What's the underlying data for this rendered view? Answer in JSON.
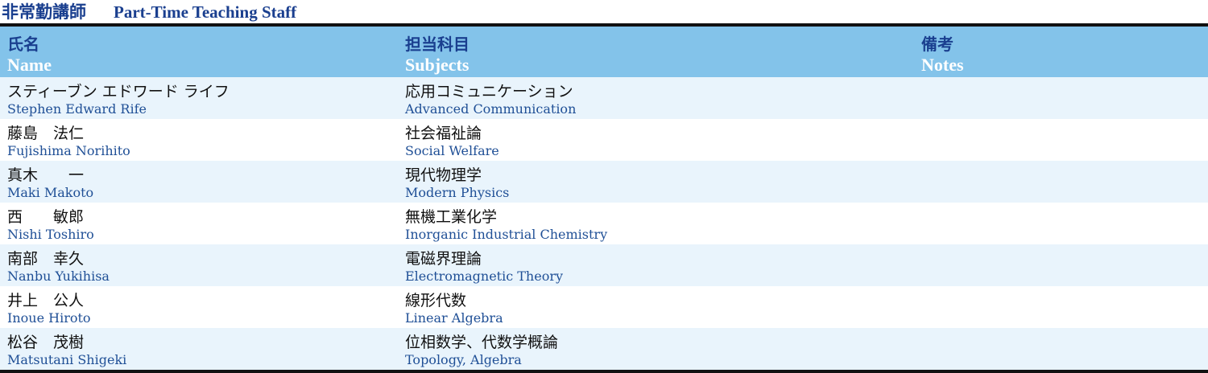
{
  "title": {
    "ja": "非常勤講師",
    "en": "Part-Time Teaching Staff"
  },
  "headers": {
    "name": {
      "ja": "氏名",
      "en": "Name"
    },
    "subjects": {
      "ja": "担当科目",
      "en": "Subjects"
    },
    "notes": {
      "ja": "備考",
      "en": "Notes"
    }
  },
  "rows": [
    {
      "name_ja": "スティーブン エドワード ライフ",
      "name_en": "Stephen Edward Rife",
      "subject_ja": "応用コミュニケーション",
      "subject_en": "Advanced Communication"
    },
    {
      "name_ja": "藤島　法仁",
      "name_en": "Fujishima Norihito",
      "subject_ja": "社会福祉論",
      "subject_en": "Social Welfare"
    },
    {
      "name_ja": "真木　　一",
      "name_en": "Maki Makoto",
      "subject_ja": "現代物理学",
      "subject_en": "Modern Physics"
    },
    {
      "name_ja": "西　　敏郎",
      "name_en": "Nishi Toshiro",
      "subject_ja": "無機工業化学",
      "subject_en": "Inorganic Industrial Chemistry"
    },
    {
      "name_ja": "南部　幸久",
      "name_en": "Nanbu Yukihisa",
      "subject_ja": "電磁界理論",
      "subject_en": "Electromagnetic Theory"
    },
    {
      "name_ja": "井上　公人",
      "name_en": "Inoue Hiroto",
      "subject_ja": "線形代数",
      "subject_en": "Linear Algebra"
    },
    {
      "name_ja": "松谷　茂樹",
      "name_en": "Matsutani Shigeki",
      "subject_ja": "位相数学、代数学概論",
      "subject_en": "Topology, Algebra"
    }
  ]
}
